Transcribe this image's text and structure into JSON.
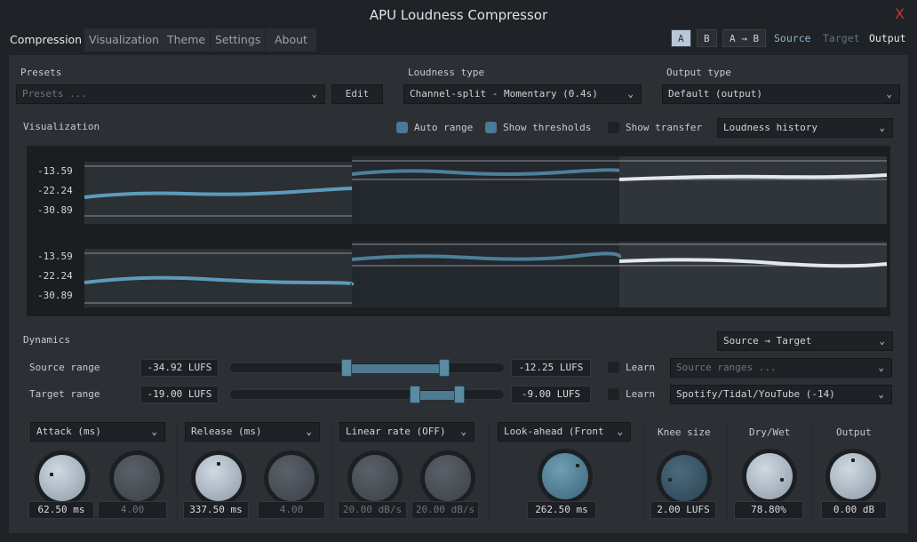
{
  "window": {
    "title": "APU Loudness Compressor",
    "close": "X"
  },
  "tabs": [
    {
      "label": "Compression",
      "active": true
    },
    {
      "label": "Visualization"
    },
    {
      "label": "Theme"
    },
    {
      "label": "Settings"
    },
    {
      "label": "About"
    }
  ],
  "ab": {
    "a": "A",
    "b": "B",
    "copy": "A → B",
    "source": "Source",
    "target": "Target",
    "output": "Output"
  },
  "presets": {
    "label": "Presets",
    "placeholder": "Presets ...",
    "edit": "Edit"
  },
  "loudness_type": {
    "label": "Loudness type",
    "value": "Channel-split - Momentary (0.4s)"
  },
  "output_type": {
    "label": "Output type",
    "value": "Default (output)"
  },
  "visualization": {
    "label": "Visualization",
    "auto_range": "Auto range",
    "auto_range_checked": true,
    "show_thresholds": "Show thresholds",
    "show_thresholds_checked": true,
    "show_transfer": "Show transfer",
    "show_transfer_checked": false,
    "mode": "Loudness history",
    "y_labels": [
      "-13.59",
      "-22.24",
      "-30.89"
    ]
  },
  "dynamics": {
    "label": "Dynamics",
    "mode": "Source → Target",
    "source_range": {
      "label": "Source range",
      "min": "-34.92 LUFS",
      "max": "-12.25 LUFS",
      "learn": "Learn",
      "preset_placeholder": "Source ranges ..."
    },
    "target_range": {
      "label": "Target range",
      "min": "-19.00 LUFS",
      "max": "-9.00 LUFS",
      "learn": "Learn",
      "preset": "Spotify/Tidal/YouTube (-14)"
    }
  },
  "knobs": {
    "attack": {
      "label": "Attack (ms)",
      "value": "62.50 ms",
      "value2": "4.00"
    },
    "release": {
      "label": "Release (ms)",
      "value": "337.50 ms",
      "value2": "4.00"
    },
    "linear": {
      "label": "Linear rate (OFF)",
      "value": "20.00 dB/s",
      "value2": "20.00 dB/s"
    },
    "lookahead": {
      "label": "Look-ahead (Front",
      "value": "262.50 ms"
    },
    "knee": {
      "label": "Knee size",
      "value": "2.00 LUFS"
    },
    "drywet": {
      "label": "Dry/Wet",
      "value": "78.80%"
    },
    "output": {
      "label": "Output",
      "value": "0.00 dB"
    }
  },
  "colors": {
    "accent": "#4e7a92",
    "close": "#c0392b",
    "source_link": "#8fb4cc",
    "target_link": "#5d7585"
  }
}
